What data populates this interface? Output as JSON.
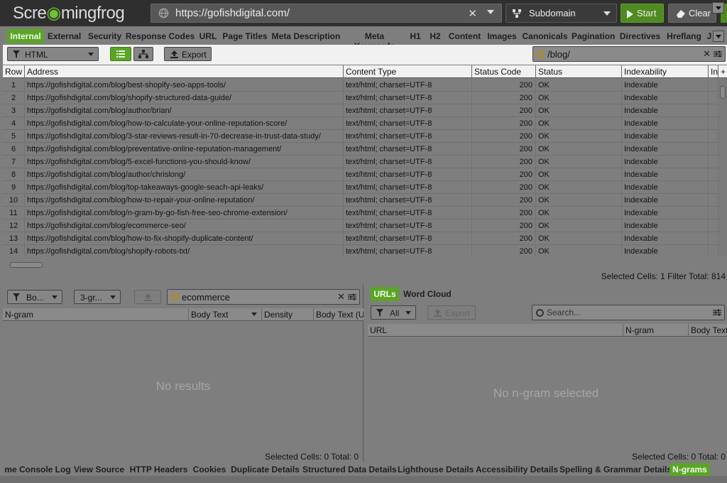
{
  "app": {
    "logo_pre": "Scre",
    "logo_mid": "mingfrog",
    "url": "https://gofishdigital.com/",
    "mode": "Subdomain",
    "start_label": "Start",
    "clear_label": "Clear"
  },
  "tabs": [
    {
      "label": "Internal",
      "active": true
    },
    {
      "label": "External"
    },
    {
      "label": "Security"
    },
    {
      "label": "Response Codes"
    },
    {
      "label": "URL"
    },
    {
      "label": "Page Titles"
    },
    {
      "label": "Meta Description"
    },
    {
      "label": "Meta Keywords"
    },
    {
      "label": "H1"
    },
    {
      "label": "H2"
    },
    {
      "label": "Content"
    },
    {
      "label": "Images"
    },
    {
      "label": "Canonicals"
    },
    {
      "label": "Pagination"
    },
    {
      "label": "Directives"
    },
    {
      "label": "Hreflang"
    },
    {
      "label": "J"
    }
  ],
  "toolbar": {
    "filter_value": "HTML",
    "export_label": "Export",
    "search_value": "/blog/"
  },
  "table": {
    "columns": [
      "Row",
      "Address",
      "Content Type",
      "Status Code",
      "Status",
      "Indexability",
      "In"
    ],
    "rows": [
      [
        "1",
        "https://gofishdigital.com/blog/best-shopify-seo-apps-tools/",
        "text/html; charset=UTF-8",
        "200",
        "OK",
        "Indexable"
      ],
      [
        "2",
        "https://gofishdigital.com/blog/shopify-structured-data-guide/",
        "text/html; charset=UTF-8",
        "200",
        "OK",
        "Indexable"
      ],
      [
        "3",
        "https://gofishdigital.com/blog/author/brian/",
        "text/html; charset=UTF-8",
        "200",
        "OK",
        "Indexable"
      ],
      [
        "4",
        "https://gofishdigital.com/blog/how-to-calculate-your-online-reputation-score/",
        "text/html; charset=UTF-8",
        "200",
        "OK",
        "Indexable"
      ],
      [
        "5",
        "https://gofishdigital.com/blog/3-star-reviews-result-in-70-decrease-in-trust-data-study/",
        "text/html; charset=UTF-8",
        "200",
        "OK",
        "Indexable"
      ],
      [
        "6",
        "https://gofishdigital.com/blog/preventative-online-reputation-management/",
        "text/html; charset=UTF-8",
        "200",
        "OK",
        "Indexable"
      ],
      [
        "7",
        "https://gofishdigital.com/blog/5-excel-functions-you-should-know/",
        "text/html; charset=UTF-8",
        "200",
        "OK",
        "Indexable"
      ],
      [
        "8",
        "https://gofishdigital.com/blog/author/chrislong/",
        "text/html; charset=UTF-8",
        "200",
        "OK",
        "Indexable"
      ],
      [
        "9",
        "https://gofishdigital.com/blog/top-takeaways-google-seach-api-leaks/",
        "text/html; charset=UTF-8",
        "200",
        "OK",
        "Indexable"
      ],
      [
        "10",
        "https://gofishdigital.com/blog/how-to-repair-your-online-reputation/",
        "text/html; charset=UTF-8",
        "200",
        "OK",
        "Indexable"
      ],
      [
        "11",
        "https://gofishdigital.com/blog/n-gram-by-go-fish-free-seo-chrome-extension/",
        "text/html; charset=UTF-8",
        "200",
        "OK",
        "Indexable"
      ],
      [
        "12",
        "https://gofishdigital.com/blog/ecommerce-seo/",
        "text/html; charset=UTF-8",
        "200",
        "OK",
        "Indexable"
      ],
      [
        "13",
        "https://gofishdigital.com/blog/how-to-fix-shopify-duplicate-content/",
        "text/html; charset=UTF-8",
        "200",
        "OK",
        "Indexable"
      ],
      [
        "14",
        "https://gofishdigital.com/blog/shopify-robots-txt/",
        "text/html; charset=UTF-8",
        "200",
        "OK",
        "Indexable"
      ]
    ],
    "status": "Selected Cells:  1  Filter Total:  814"
  },
  "ngram_panel": {
    "dd1": "Bo...",
    "dd2": "3-gr...",
    "search_value": "ecommerce",
    "columns": [
      "N-gram",
      "Body Text",
      "Density",
      "Body Text (U"
    ],
    "empty": "No results",
    "status": "Selected Cells:  0  Total:  0"
  },
  "urls_panel": {
    "tab_urls": "URLs",
    "tab_wordcloud": "Word Cloud",
    "filter_value": "All",
    "export_label": "Export",
    "search_placeholder": "Search...",
    "columns": [
      "URL",
      "N-gram",
      "Body Text"
    ],
    "empty": "No n-gram selected",
    "status": "Selected Cells:  0  Total:  0"
  },
  "bottom_tabs": [
    {
      "label": "me Console Log"
    },
    {
      "label": "View Source"
    },
    {
      "label": "HTTP Headers"
    },
    {
      "label": "Cookies"
    },
    {
      "label": "Duplicate Details"
    },
    {
      "label": "Structured Data Details"
    },
    {
      "label": "Lighthouse Details"
    },
    {
      "label": "Accessibility Details"
    },
    {
      "label": "Spelling & Grammar Details"
    },
    {
      "label": "N-grams",
      "active": true
    }
  ],
  "colors": {
    "accent_green": "#5aa526",
    "topbar": "#2f2f2f",
    "panel": "#7e7e7e"
  }
}
